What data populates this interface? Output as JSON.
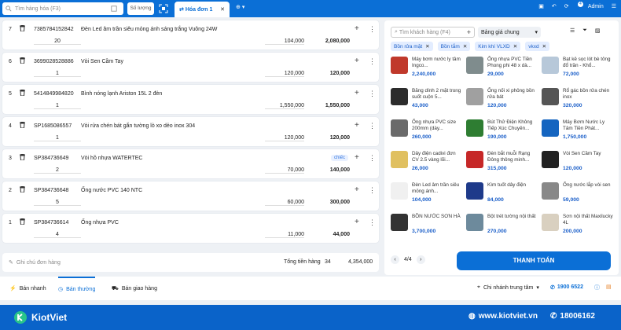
{
  "topbar": {
    "search_placeholder": "Tìm hàng hóa (F3)",
    "qty_button": "Số lượng",
    "tab_label": "Hóa đơn 1",
    "notification_count": "4",
    "user": "Admin"
  },
  "order_rows": [
    {
      "index": "7",
      "code": "7385784152842",
      "name": "Đèn Led âm trần siêu mỏng ánh sáng trắng Vuông 24W",
      "unit": "",
      "qty": "20",
      "price": "104,000",
      "total": "2,080,000"
    },
    {
      "index": "6",
      "code": "3699028528886",
      "name": "Vòi Sen Cầm Tay",
      "unit": "",
      "qty": "1",
      "price": "120,000",
      "total": "120,000"
    },
    {
      "index": "5",
      "code": "5414849984820",
      "name": "Bình nóng lạnh Ariston 15L 2 đèn",
      "unit": "",
      "qty": "1",
      "price": "1,550,000",
      "total": "1,550,000"
    },
    {
      "index": "4",
      "code": "SP1685086557",
      "name": "Vòi rửa chén bát gắn tường lò xo dẻo inox 304",
      "unit": "",
      "qty": "1",
      "price": "120,000",
      "total": "120,000"
    },
    {
      "index": "3",
      "code": "SP384736649",
      "name": "Vòi hồ nhựa WATERTEC",
      "unit": "chiếc",
      "qty": "2",
      "price": "70,000",
      "total": "140,000"
    },
    {
      "index": "2",
      "code": "SP384736648",
      "name": "Ống nước PVC 140 NTC",
      "unit": "",
      "qty": "5",
      "price": "60,000",
      "total": "300,000"
    },
    {
      "index": "1",
      "code": "SP384736614",
      "name": "Ống nhựa PVC",
      "unit": "",
      "qty": "4",
      "price": "11,000",
      "total": "44,000"
    }
  ],
  "footer": {
    "note_placeholder": "Ghi chú đơn hàng",
    "sum_label": "Tổng tiền hàng",
    "sum_qty": "34",
    "sum_total": "4,354,000"
  },
  "right_panel": {
    "customer_search": "Tìm khách hàng (F4)",
    "price_list": "Bảng giá chung",
    "chips": [
      "Bồn rửa mặt",
      "Bồn tắm",
      "Kim khí VLXD",
      "vkxd"
    ],
    "products": [
      {
        "name": "Máy bơm nước ly tâm Ingco...",
        "price": "2,240,000",
        "color": "#c0392b"
      },
      {
        "name": "Ống nhựa PVC Tiền Phong phi 48 x dà...",
        "price": "29,000",
        "color": "#7f8c8d"
      },
      {
        "name": "Bạt kê sọc lót bè tông đổ trần - Khổ...",
        "price": "72,000",
        "color": "#b7c8d9"
      },
      {
        "name": "Băng dính 2 mặt trong suốt cuộn 5...",
        "price": "43,000",
        "color": "#2c2c2c"
      },
      {
        "name": "Ống nối xi phông bồn rửa bát",
        "price": "120,000",
        "color": "#a0a0a0"
      },
      {
        "name": "Rổ gác bồn rửa chén inox",
        "price": "320,000",
        "color": "#555"
      },
      {
        "name": "Ống nhựa PVC size 200mm (dày...",
        "price": "260,000",
        "color": "#6a6a6a"
      },
      {
        "name": "Bút Thử Điện Không Tiếp Xúc Chuyên...",
        "price": "190,000",
        "color": "#2e7d32"
      },
      {
        "name": "Máy Bơm Nước Ly Tâm Tiền Phát...",
        "price": "1,750,000",
        "color": "#1565c0"
      },
      {
        "name": "Dây điện cadivi đơn CV 2.5 vàng lõi...",
        "price": "26,000",
        "color": "#e0c060"
      },
      {
        "name": "Đèn bắt muỗi Rạng Đông thông minh...",
        "price": "315,000",
        "color": "#c62828"
      },
      {
        "name": "Vòi Sen Cầm Tay",
        "price": "120,000",
        "color": "#222"
      },
      {
        "name": "Đèn Led âm trần siêu mỏng ánh...",
        "price": "104,000",
        "color": "#f0f0f0"
      },
      {
        "name": "Kìm tuốt dây điện",
        "price": "84,000",
        "color": "#1e3a8a"
      },
      {
        "name": "Ống nước lắp vòi sen",
        "price": "59,000",
        "color": "#888"
      },
      {
        "name": "BỒN NƯỚC SƠN HÀ",
        "price": "3,700,000",
        "color": "#333"
      },
      {
        "name": "Bột trét tường nội thất",
        "price": "270,000",
        "color": "#6d8a9c"
      },
      {
        "name": "Sơn nội thất Maxilucky 4L",
        "price": "200,000",
        "color": "#d9d0c0"
      }
    ],
    "pager": "4/4",
    "pay_button": "THANH TOÁN"
  },
  "bottombar": {
    "modes": [
      "Bán nhanh",
      "Bán thường",
      "Bán giao hàng"
    ],
    "branch": "Chi nhánh trung tâm",
    "hotline": "1900 6522"
  },
  "brand": {
    "name": "KiotViet",
    "website": "www.kiotviet.vn",
    "phone": "18006162"
  }
}
